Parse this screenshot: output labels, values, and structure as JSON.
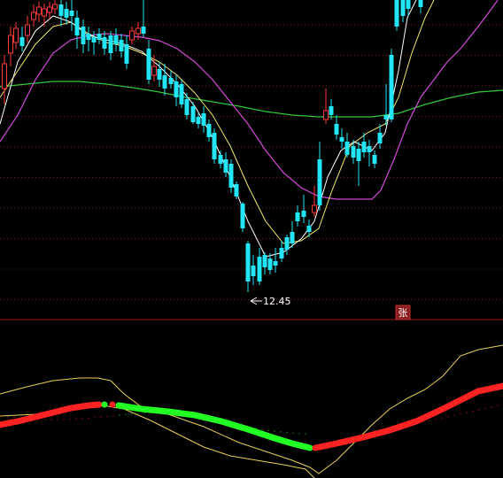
{
  "chart_data": {
    "type": "candlestick",
    "annotations": {
      "low_price": "12.45",
      "badge": "张"
    },
    "colors": {
      "background": "#000000",
      "up": "#ff3b3b",
      "down": "#22e6f5",
      "ma_short": "#ffffff",
      "ma_mid": "#f2e86a",
      "ma_long": "#d04ad8",
      "ma_longest": "#2ec83a",
      "grid": "#7a1a1a",
      "divider": "#a01818",
      "indicator_up": "#ff2222",
      "indicator_down": "#22ff22",
      "band_upper": "#e8d05a",
      "band_lower": "#e8d05a"
    },
    "grid": true,
    "indicator_panel": {
      "type": "band-with-trend-line",
      "segments": [
        "red",
        "green",
        "red"
      ]
    }
  }
}
